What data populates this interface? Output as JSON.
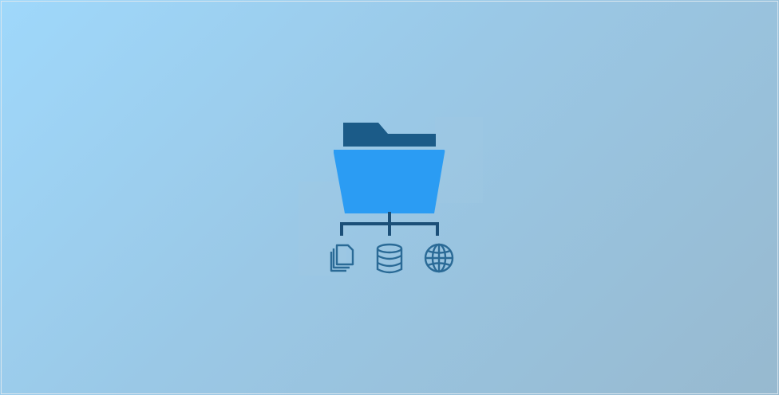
{
  "theme": {
    "folder_front": "#2b9cf3",
    "folder_tab": "#1b5b88",
    "line": "#1b4f78",
    "icon_stroke": "#2a6a96"
  },
  "icons": {
    "folder": "folder-icon",
    "documents": "documents-icon",
    "database": "database-icon",
    "globe": "globe-icon"
  }
}
